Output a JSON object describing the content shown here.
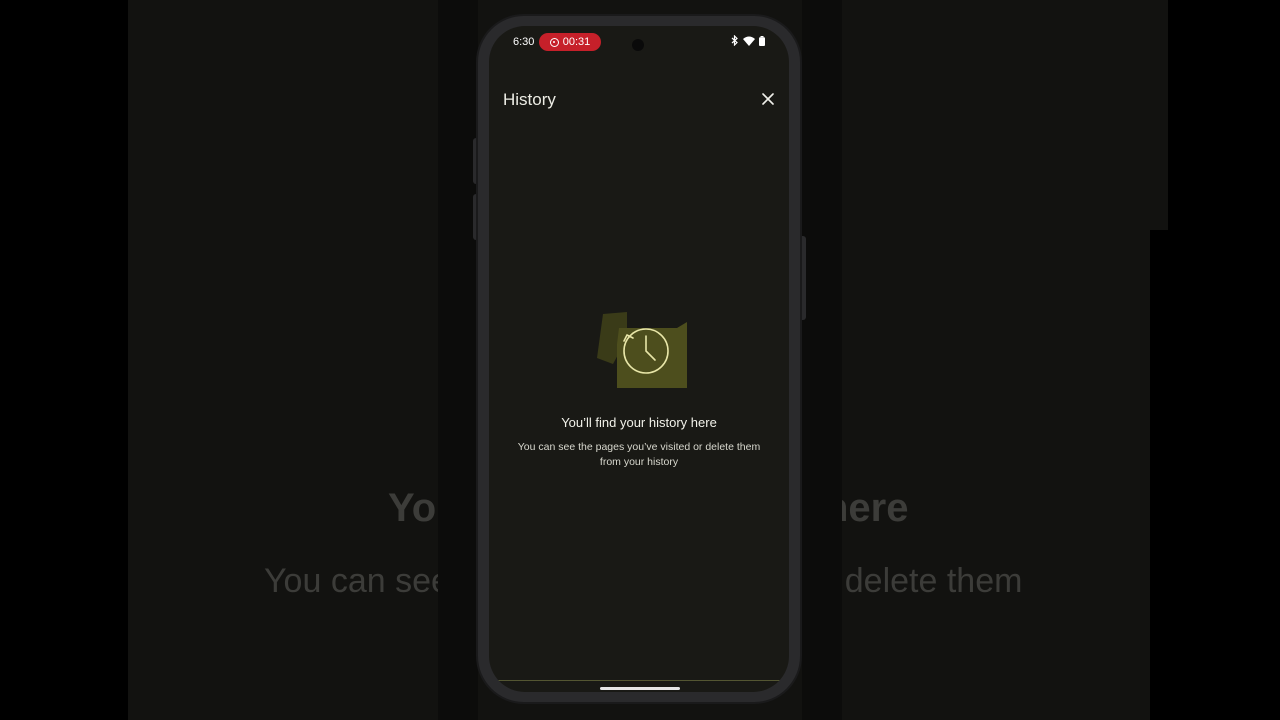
{
  "backdrop": {
    "line1_left": "You",
    "line1_right": "here",
    "line2_left": "You can see",
    "line2_right": "r delete them"
  },
  "status_bar": {
    "time": "6:30",
    "recording_time": "00:31",
    "icons": [
      "bluetooth-icon",
      "wifi-icon",
      "battery-icon"
    ]
  },
  "app_bar": {
    "title": "History",
    "close_icon": "close-icon"
  },
  "empty_state": {
    "illustration_icon": "history-clock-icon",
    "heading": "You’ll find your history here",
    "description": "You can see the pages you’ve visited or delete them from your history"
  },
  "colors": {
    "screen_bg": "#191915",
    "recording": "#c6202a",
    "illustration_blob": "#4d4e1d",
    "illustration_stroke": "#e8e6a8"
  }
}
